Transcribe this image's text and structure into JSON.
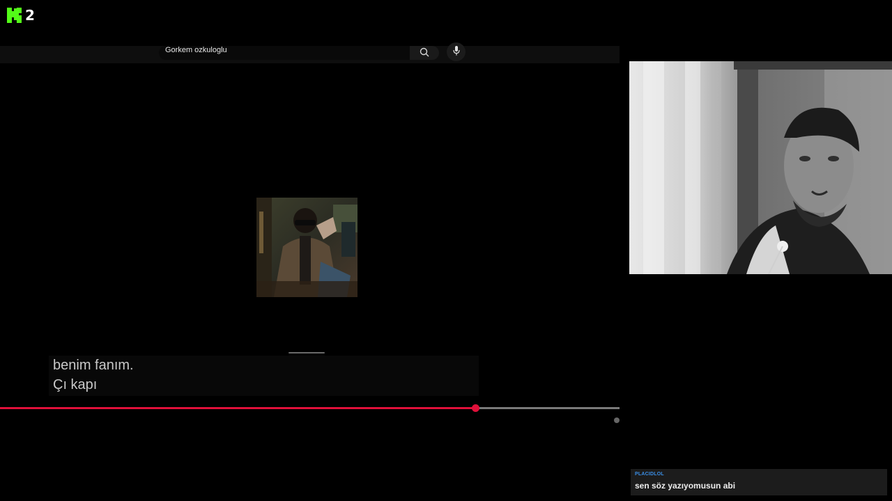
{
  "brand": {
    "logo_icon": "kick-logo-icon",
    "logo_number": "2",
    "accent_color": "#53fc18"
  },
  "search": {
    "query": "Gorkem ozkuloglu",
    "search_icon": "search-icon",
    "mic_icon": "microphone-icon"
  },
  "player": {
    "album_art": "album-art-image",
    "caption_line1": "benim fanım.",
    "caption_line2": "Çı kapı",
    "progress_fraction": 0.767,
    "progress_color": "#e0103a"
  },
  "webcam": {
    "label": "webcam-feed"
  },
  "chat": {
    "separator": "________________________________",
    "messages": [
      {
        "username": "PLACIDLOL",
        "text": "sen söz yazıyomusun abi",
        "user_color": "#3a8ee6"
      }
    ]
  }
}
